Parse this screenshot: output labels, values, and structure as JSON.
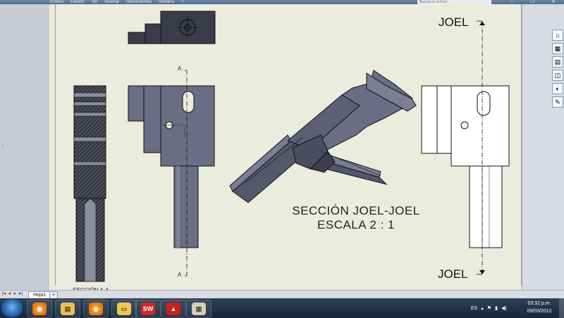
{
  "window": {
    "menu": [
      "Archivo",
      "Edición",
      "Ver",
      "Insertar",
      "Herramientas",
      "Ventana",
      "?"
    ],
    "search_placeholder": "Buscar en el Foro"
  },
  "drawing": {
    "section_view_label": "SECCIÓN A-A",
    "cut_letter_top": "A",
    "cut_letter_bottom": "A",
    "section_title_line1": "SECCIÓN JOEL-JOEL",
    "section_title_line2": "ESCALA 2 : 1",
    "joel_top": "JOEL",
    "joel_bottom": "JOEL"
  },
  "tabs": {
    "sheet_tab": "Hoja1"
  },
  "taskbar": {
    "apps": [
      "firefox-icon",
      "explorer-icon",
      "firefox-icon",
      "folder-icon",
      "solidworks-icon",
      "acrobat-icon",
      "edrawings-icon"
    ],
    "language": "ES",
    "time": "03:32 p.m.",
    "date": "09/03/2012"
  },
  "colors": {
    "sheet": "#ececde",
    "part_fill": "#6a6d84",
    "part_dark": "#3d3f4a",
    "taskbar": "#1f3148"
  }
}
